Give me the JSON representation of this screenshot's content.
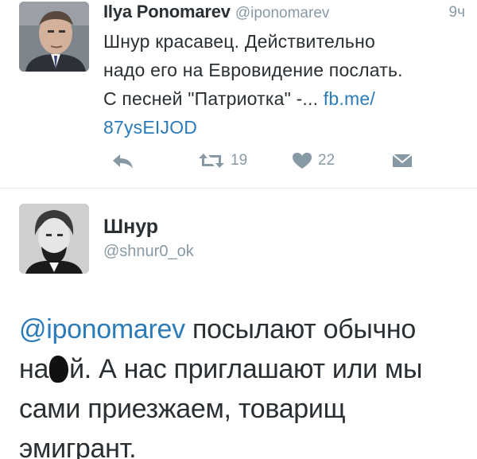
{
  "tweet1": {
    "author_name": "Ilya Ponomarev",
    "author_handle": "@iponomarev",
    "timestamp": "9ч",
    "text_lines": [
      "Шнур красавец. Действительно",
      "надо его на Евровидение послать.",
      "С песней \"Патриотка\" -..."
    ],
    "link_part1": "fb.me/",
    "link_part2": "87ysEIJOD",
    "reply_icon": "reply-icon",
    "retweet_icon": "retweet-icon",
    "retweet_count": "19",
    "like_icon": "heart-icon",
    "like_count": "22",
    "dm_icon": "envelope-icon"
  },
  "tweet2": {
    "author_name": "Шнур",
    "author_handle": "@shnur0_ok",
    "mention": "@iponomarev",
    "text_after_mention": " посылают обычно",
    "line2_start": "на",
    "line2_end": "й. А нас приглашают или мы",
    "line3": "сами приезжаем, товарищ",
    "line4": "эмигрант."
  },
  "colors": {
    "link": "#2b7bb9",
    "muted": "#8899a6",
    "text": "#292f33",
    "divider": "#e1e8ed"
  }
}
